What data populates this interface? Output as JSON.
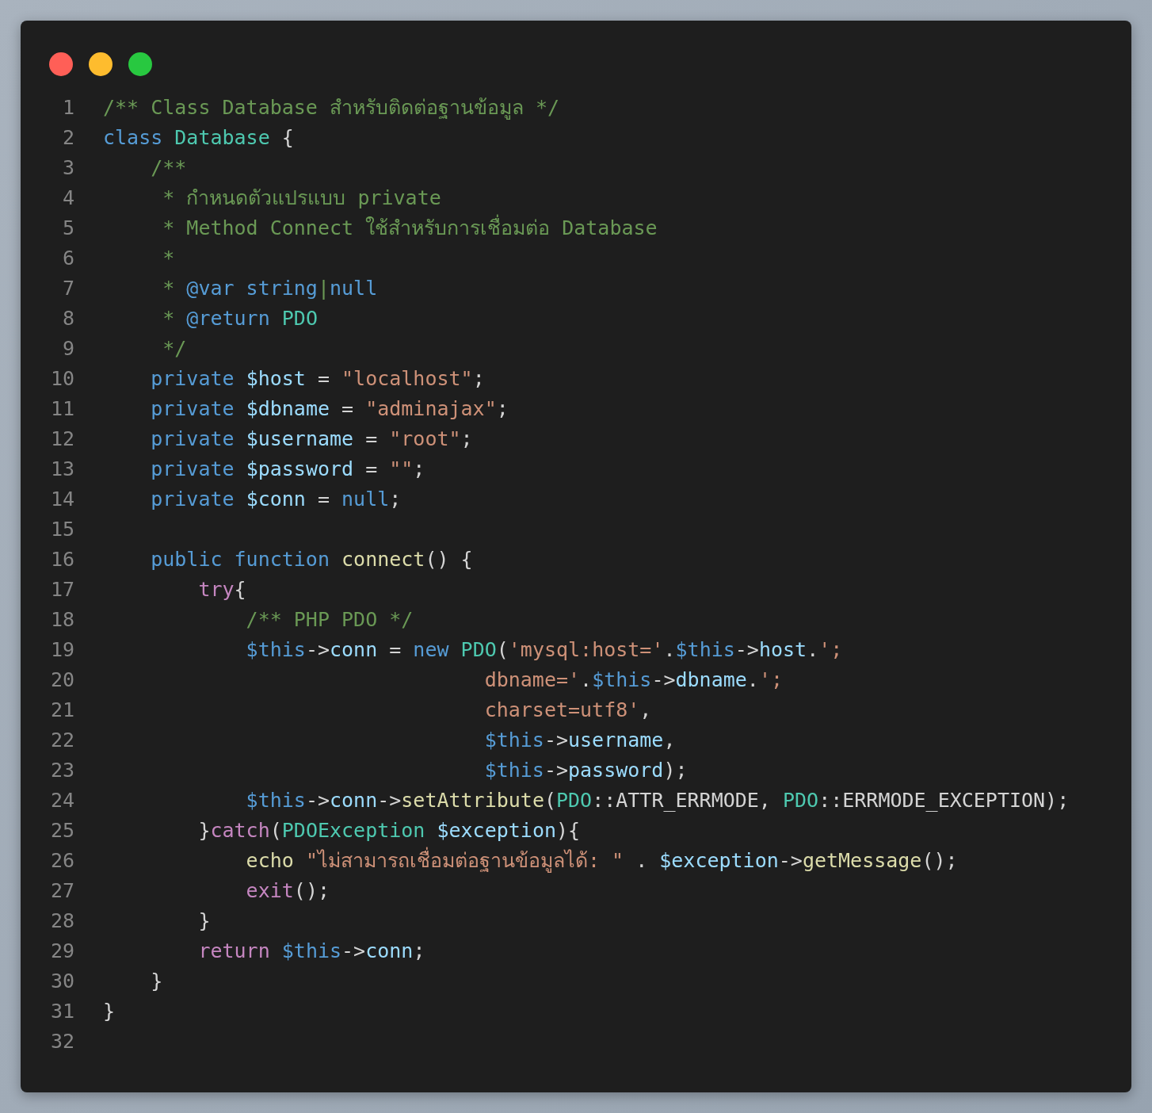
{
  "window": {
    "controls": [
      {
        "kind": "close"
      },
      {
        "kind": "minimize"
      },
      {
        "kind": "maximize"
      }
    ]
  },
  "code": {
    "lines": [
      {
        "number": "1",
        "tokens": [
          {
            "text": "/** Class Database สำหรับติดต่อฐานข้อมูล */",
            "kind": "comment"
          }
        ]
      },
      {
        "number": "2",
        "tokens": [
          {
            "text": "class ",
            "kind": "keyword"
          },
          {
            "text": "Database",
            "kind": "type"
          },
          {
            "text": " {",
            "kind": "plain"
          }
        ]
      },
      {
        "number": "3",
        "tokens": [
          {
            "text": "    /**",
            "kind": "comment"
          }
        ]
      },
      {
        "number": "4",
        "tokens": [
          {
            "text": "     * กำหนดตัวแปรแบบ private",
            "kind": "comment"
          }
        ]
      },
      {
        "number": "5",
        "tokens": [
          {
            "text": "     * Method Connect ใช้สำหรับการเชื่อมต่อ Database",
            "kind": "comment"
          }
        ]
      },
      {
        "number": "6",
        "tokens": [
          {
            "text": "     *",
            "kind": "comment"
          }
        ]
      },
      {
        "number": "7",
        "tokens": [
          {
            "text": "     * ",
            "kind": "comment"
          },
          {
            "text": "@var string",
            "kind": "keyword"
          },
          {
            "text": "|",
            "kind": "comment"
          },
          {
            "text": "null",
            "kind": "keyword"
          }
        ]
      },
      {
        "number": "8",
        "tokens": [
          {
            "text": "     * ",
            "kind": "comment"
          },
          {
            "text": "@return ",
            "kind": "keyword"
          },
          {
            "text": "PDO",
            "kind": "type"
          }
        ]
      },
      {
        "number": "9",
        "tokens": [
          {
            "text": "     */",
            "kind": "comment"
          }
        ]
      },
      {
        "number": "10",
        "tokens": [
          {
            "text": "    private ",
            "kind": "keyword"
          },
          {
            "text": "$host",
            "kind": "variable"
          },
          {
            "text": " = ",
            "kind": "plain"
          },
          {
            "text": "\"localhost\"",
            "kind": "string"
          },
          {
            "text": ";",
            "kind": "plain"
          }
        ]
      },
      {
        "number": "11",
        "tokens": [
          {
            "text": "    private ",
            "kind": "keyword"
          },
          {
            "text": "$dbname",
            "kind": "variable"
          },
          {
            "text": " = ",
            "kind": "plain"
          },
          {
            "text": "\"adminajax\"",
            "kind": "string"
          },
          {
            "text": ";",
            "kind": "plain"
          }
        ]
      },
      {
        "number": "12",
        "tokens": [
          {
            "text": "    private ",
            "kind": "keyword"
          },
          {
            "text": "$username",
            "kind": "variable"
          },
          {
            "text": " = ",
            "kind": "plain"
          },
          {
            "text": "\"root\"",
            "kind": "string"
          },
          {
            "text": ";",
            "kind": "plain"
          }
        ]
      },
      {
        "number": "13",
        "tokens": [
          {
            "text": "    private ",
            "kind": "keyword"
          },
          {
            "text": "$password",
            "kind": "variable"
          },
          {
            "text": " = ",
            "kind": "plain"
          },
          {
            "text": "\"\"",
            "kind": "string"
          },
          {
            "text": ";",
            "kind": "plain"
          }
        ]
      },
      {
        "number": "14",
        "tokens": [
          {
            "text": "    private ",
            "kind": "keyword"
          },
          {
            "text": "$conn",
            "kind": "variable"
          },
          {
            "text": " = ",
            "kind": "plain"
          },
          {
            "text": "null",
            "kind": "keyword"
          },
          {
            "text": ";",
            "kind": "plain"
          }
        ]
      },
      {
        "number": "15"
      },
      {
        "number": "16",
        "tokens": [
          {
            "text": "    public function ",
            "kind": "keyword"
          },
          {
            "text": "connect",
            "kind": "function"
          },
          {
            "text": "() {",
            "kind": "plain"
          }
        ]
      },
      {
        "number": "17",
        "tokens": [
          {
            "text": "        try",
            "kind": "control"
          },
          {
            "text": "{",
            "kind": "plain"
          }
        ]
      },
      {
        "number": "18",
        "tokens": [
          {
            "text": "            /** PHP PDO */",
            "kind": "comment"
          }
        ]
      },
      {
        "number": "19",
        "tokens": [
          {
            "text": "            $this",
            "kind": "keyword"
          },
          {
            "text": "->",
            "kind": "plain"
          },
          {
            "text": "conn",
            "kind": "variable"
          },
          {
            "text": " = ",
            "kind": "plain"
          },
          {
            "text": "new ",
            "kind": "keyword"
          },
          {
            "text": "PDO",
            "kind": "type"
          },
          {
            "text": "(",
            "kind": "plain"
          },
          {
            "text": "'mysql:host='",
            "kind": "string"
          },
          {
            "text": ".",
            "kind": "plain"
          },
          {
            "text": "$this",
            "kind": "keyword"
          },
          {
            "text": "->",
            "kind": "plain"
          },
          {
            "text": "host",
            "kind": "variable"
          },
          {
            "text": ".",
            "kind": "plain"
          },
          {
            "text": "';",
            "kind": "string"
          }
        ]
      },
      {
        "number": "20",
        "tokens": [
          {
            "text": "                                dbname='",
            "kind": "string"
          },
          {
            "text": ".",
            "kind": "plain"
          },
          {
            "text": "$this",
            "kind": "keyword"
          },
          {
            "text": "->",
            "kind": "plain"
          },
          {
            "text": "dbname",
            "kind": "variable"
          },
          {
            "text": ".",
            "kind": "plain"
          },
          {
            "text": "';",
            "kind": "string"
          }
        ]
      },
      {
        "number": "21",
        "tokens": [
          {
            "text": "                                charset=utf8'",
            "kind": "string"
          },
          {
            "text": ",",
            "kind": "plain"
          }
        ]
      },
      {
        "number": "22",
        "tokens": [
          {
            "text": "                                $this",
            "kind": "keyword"
          },
          {
            "text": "->",
            "kind": "plain"
          },
          {
            "text": "username",
            "kind": "variable"
          },
          {
            "text": ",",
            "kind": "plain"
          }
        ]
      },
      {
        "number": "23",
        "tokens": [
          {
            "text": "                                $this",
            "kind": "keyword"
          },
          {
            "text": "->",
            "kind": "plain"
          },
          {
            "text": "password",
            "kind": "variable"
          },
          {
            "text": ");",
            "kind": "plain"
          }
        ]
      },
      {
        "number": "24",
        "tokens": [
          {
            "text": "            $this",
            "kind": "keyword"
          },
          {
            "text": "->",
            "kind": "plain"
          },
          {
            "text": "conn",
            "kind": "variable"
          },
          {
            "text": "->",
            "kind": "plain"
          },
          {
            "text": "setAttribute",
            "kind": "function"
          },
          {
            "text": "(",
            "kind": "plain"
          },
          {
            "text": "PDO",
            "kind": "type"
          },
          {
            "text": "::ATTR_ERRMODE, ",
            "kind": "plain"
          },
          {
            "text": "PDO",
            "kind": "type"
          },
          {
            "text": "::ERRMODE_EXCEPTION);",
            "kind": "plain"
          }
        ]
      },
      {
        "number": "25",
        "tokens": [
          {
            "text": "        }",
            "kind": "plain"
          },
          {
            "text": "catch",
            "kind": "control"
          },
          {
            "text": "(",
            "kind": "plain"
          },
          {
            "text": "PDOException ",
            "kind": "type"
          },
          {
            "text": "$exception",
            "kind": "variable"
          },
          {
            "text": "){",
            "kind": "plain"
          }
        ]
      },
      {
        "number": "26",
        "tokens": [
          {
            "text": "            echo ",
            "kind": "function"
          },
          {
            "text": "\"ไม่สามารถเชื่อมต่อฐานข้อมูลได้: \"",
            "kind": "string"
          },
          {
            "text": " . ",
            "kind": "plain"
          },
          {
            "text": "$exception",
            "kind": "variable"
          },
          {
            "text": "->",
            "kind": "plain"
          },
          {
            "text": "getMessage",
            "kind": "function"
          },
          {
            "text": "();",
            "kind": "plain"
          }
        ]
      },
      {
        "number": "27",
        "tokens": [
          {
            "text": "            exit",
            "kind": "control"
          },
          {
            "text": "();",
            "kind": "plain"
          }
        ]
      },
      {
        "number": "28",
        "tokens": [
          {
            "text": "        }",
            "kind": "plain"
          }
        ]
      },
      {
        "number": "29",
        "tokens": [
          {
            "text": "        return ",
            "kind": "control"
          },
          {
            "text": "$this",
            "kind": "keyword"
          },
          {
            "text": "->",
            "kind": "plain"
          },
          {
            "text": "conn",
            "kind": "variable"
          },
          {
            "text": ";",
            "kind": "plain"
          }
        ]
      },
      {
        "number": "30",
        "tokens": [
          {
            "text": "    }",
            "kind": "plain"
          }
        ]
      },
      {
        "number": "31",
        "tokens": [
          {
            "text": "}",
            "kind": "plain"
          }
        ]
      },
      {
        "number": "32"
      }
    ]
  }
}
